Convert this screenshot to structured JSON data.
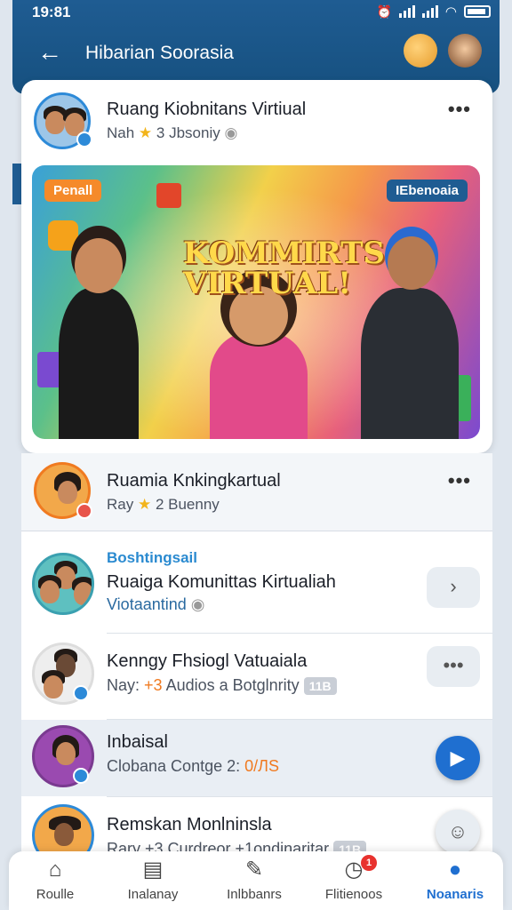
{
  "status_bar": {
    "time": "19:81"
  },
  "header": {
    "title": "Hibarian Soorasia"
  },
  "featured_post": {
    "title": "Ruang Kiobnitans Virtiual",
    "meta_prefix": "Nah",
    "meta_rest": "3 Jbsoniy",
    "banner_tag_left": "Penall",
    "banner_tag_right": "IEbenoaia",
    "banner_headline": "KOMMIRTS VIRTUAL!"
  },
  "second_post": {
    "title": "Ruamia Knkingkartual",
    "meta_prefix": "Ray",
    "meta_rest": "2 Buenny"
  },
  "list": [
    {
      "tag": "Boshtingsail",
      "title": "Ruaiga Komunittas Kirtualiah",
      "subtitle": "Viotaantind",
      "action_icon": "chevron-right-icon"
    },
    {
      "title": "Kenngy Fhsiogl Vatuaiala",
      "subtitle_prefix": "Nay:",
      "subtitle_mid": "+3",
      "subtitle_rest": "Audios a Botglnrity",
      "badge": "11B",
      "action_icon": "more-icon"
    },
    {
      "title": "Inbaisal",
      "subtitle": "Clobana Contge 2:",
      "highlight_value": "0/ЛЅ",
      "action_icon": "play-icon"
    },
    {
      "title": "Remskan Monlninsla",
      "subtitle": "Rary +3 Curdreor +1ondinaritar",
      "badge": "11B",
      "action_icon": "chat-icon"
    }
  ],
  "bottom_nav": [
    {
      "label": "Roulle",
      "icon": "home-icon"
    },
    {
      "label": "Inalanay",
      "icon": "document-icon"
    },
    {
      "label": "Inlbbanrs",
      "icon": "edit-icon"
    },
    {
      "label": "Flitienoos",
      "icon": "clock-icon",
      "notification": "1"
    },
    {
      "label": "Noanaris",
      "icon": "profile-icon",
      "active": true
    }
  ],
  "colors": {
    "primary": "#1f5c92",
    "accent": "#1f6fd0",
    "orange": "#f07a20",
    "star": "#f2b41b"
  }
}
